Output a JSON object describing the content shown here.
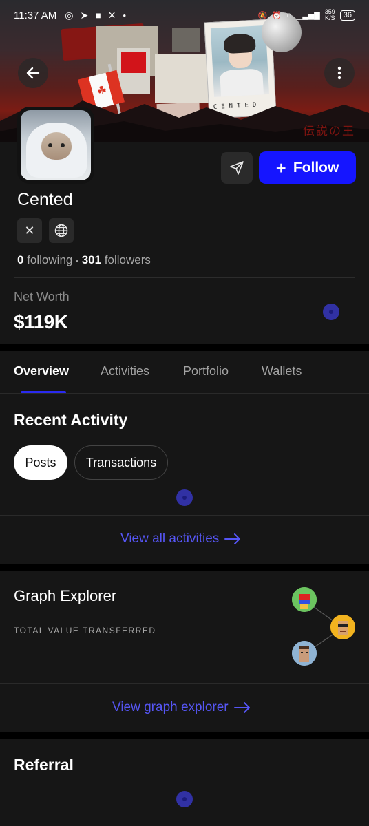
{
  "status_bar": {
    "time": "11:37 AM",
    "icons": [
      "whatsapp-icon",
      "telegram-icon",
      "video-icon",
      "x-icon",
      "dot-icon"
    ],
    "right_icons": [
      "mute-icon",
      "alarm-icon",
      "headset-icon",
      "volte-icon",
      "lte-icon",
      "signal-icon"
    ],
    "network_speed": "359\nK/S",
    "battery": "36"
  },
  "banner": {
    "polaroid_caption": "CENTED",
    "japanese_text": "伝説の王"
  },
  "profile": {
    "name": "Cented",
    "follow_label": "Follow",
    "following_count": "0",
    "following_label": "following",
    "separator": "•",
    "followers_count": "301",
    "followers_label": "followers",
    "social_links": [
      "x-icon",
      "globe-icon"
    ]
  },
  "net_worth": {
    "label": "Net Worth",
    "value": "$119K"
  },
  "tabs": [
    {
      "label": "Overview",
      "active": true
    },
    {
      "label": "Activities",
      "active": false
    },
    {
      "label": "Portfolio",
      "active": false
    },
    {
      "label": "Wallets",
      "active": false
    }
  ],
  "recent_activity": {
    "title": "Recent Activity",
    "filters": [
      {
        "label": "Posts",
        "selected": true
      },
      {
        "label": "Transactions",
        "selected": false
      }
    ],
    "view_all_label": "View all activities"
  },
  "graph_explorer": {
    "title": "Graph Explorer",
    "subtitle": "TOTAL VALUE TRANSFERRED",
    "view_label": "View graph explorer"
  },
  "referral": {
    "title": "Referral"
  },
  "colors": {
    "accent": "#1515FF",
    "link": "#5656F5",
    "panel": "#161616",
    "background": "#000000"
  }
}
